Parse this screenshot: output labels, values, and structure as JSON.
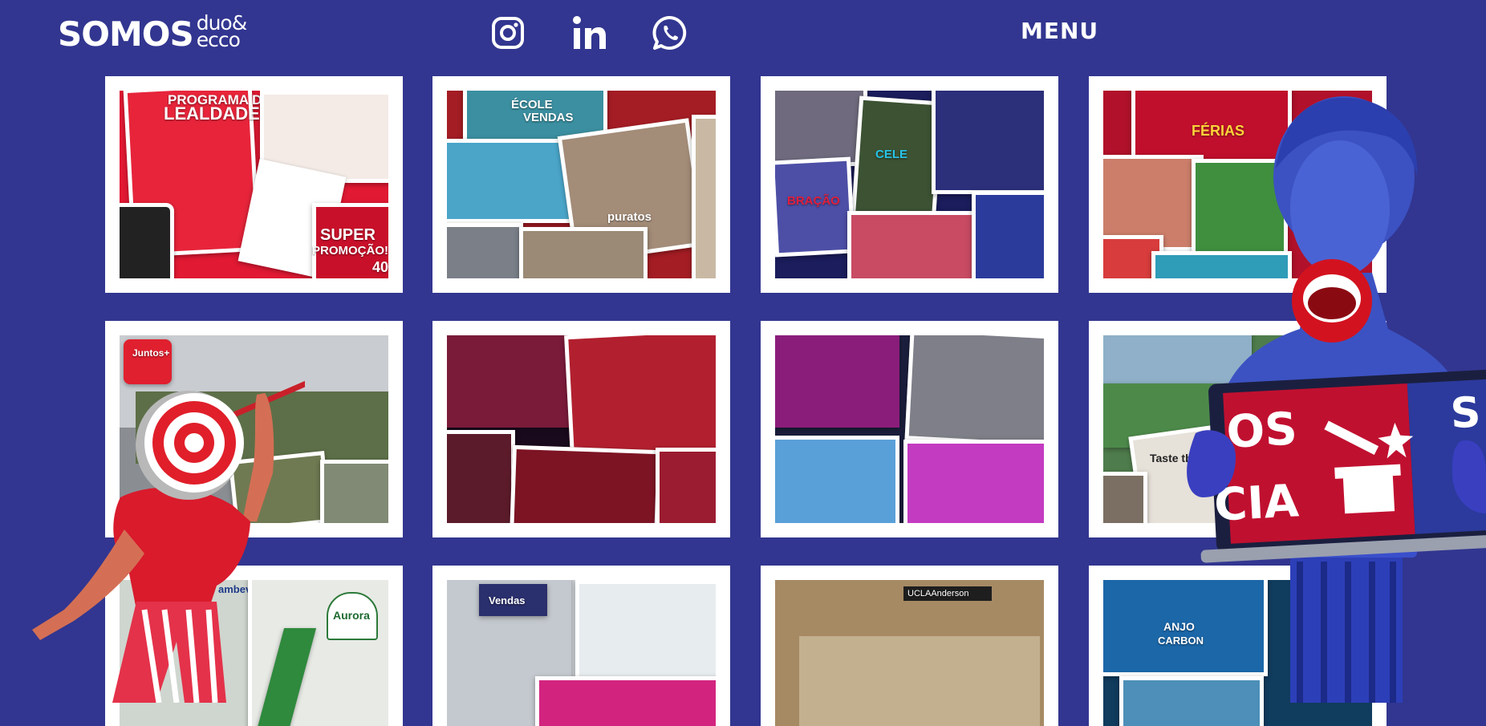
{
  "header": {
    "logo_main": "SOMOS",
    "logo_sub_top": "duo&",
    "logo_sub_bottom": "ecco",
    "menu_label": "MENU",
    "social": [
      "instagram-icon",
      "linkedin-icon",
      "whatsapp-icon"
    ]
  },
  "colors": {
    "background": "#323690",
    "accent_red": "#d8142c",
    "white": "#ffffff"
  },
  "portfolio": {
    "tiles": [
      {
        "captions": [
          "PROGRAMA DE",
          "LEALDADE",
          "SUPER",
          "PROMOÇÃO!",
          "40"
        ]
      },
      {
        "captions": [
          "ÉCOLE",
          "VENDAS",
          "puratos"
        ]
      },
      {
        "captions": [
          "CELE",
          "BRAÇÃO"
        ]
      },
      {
        "captions": [
          "FÉRIAS"
        ]
      },
      {
        "captions": [
          "Juntos+"
        ]
      },
      {
        "captions": []
      },
      {
        "captions": []
      },
      {
        "captions": [
          "Taste the f"
        ]
      },
      {
        "captions": [
          "ambev",
          "Aurora"
        ]
      },
      {
        "captions": [
          "Vendas"
        ]
      },
      {
        "captions": [
          "UCLAAnderson"
        ]
      },
      {
        "captions": [
          "ANJO",
          "CARBON"
        ]
      }
    ]
  },
  "deco": {
    "laptop_text_1": "OS",
    "laptop_text_2": "CIA",
    "laptop_text_3": "S"
  }
}
